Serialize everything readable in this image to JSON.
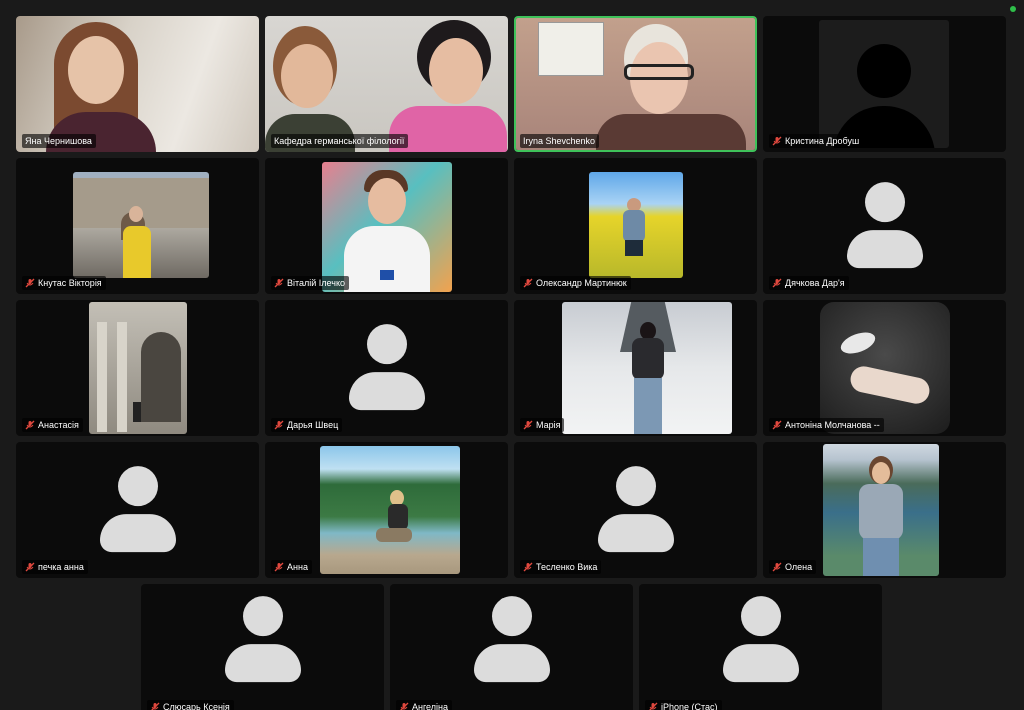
{
  "participants": [
    {
      "name": "Яна Чернишова",
      "muted": false,
      "type": "video"
    },
    {
      "name": "Кафедра германської філології",
      "muted": false,
      "type": "video"
    },
    {
      "name": "Iryna Shevchenko",
      "muted": false,
      "type": "video",
      "active": true
    },
    {
      "name": "Кристина Дробуш",
      "muted": true,
      "type": "silhouette"
    },
    {
      "name": "Кнутас Вікторія",
      "muted": true,
      "type": "photo"
    },
    {
      "name": "Віталій Ілечко",
      "muted": true,
      "type": "photo"
    },
    {
      "name": "Олександр Мартинюк",
      "muted": true,
      "type": "photo"
    },
    {
      "name": "Дячкова Дар'я",
      "muted": true,
      "type": "avatar"
    },
    {
      "name": "Анастасія",
      "muted": true,
      "type": "photo"
    },
    {
      "name": "Дарья Швец",
      "muted": true,
      "type": "avatar"
    },
    {
      "name": "Марія",
      "muted": true,
      "type": "photo"
    },
    {
      "name": "Антоніна Молчанова --",
      "muted": true,
      "type": "photo"
    },
    {
      "name": "печка анна",
      "muted": true,
      "type": "avatar"
    },
    {
      "name": "Анна",
      "muted": true,
      "type": "photo"
    },
    {
      "name": "Тесленко Вика",
      "muted": true,
      "type": "avatar"
    },
    {
      "name": "Олена",
      "muted": true,
      "type": "photo"
    },
    {
      "name": "Слюсарь Ксенія",
      "muted": true,
      "type": "avatar"
    },
    {
      "name": "Ангеліна",
      "muted": true,
      "type": "avatar"
    },
    {
      "name": "iPhone (Стас)",
      "muted": true,
      "type": "avatar"
    }
  ],
  "colors": {
    "active_speaker": "#3fc25a",
    "muted_mic": "#e0483e",
    "background": "#1a1a1a",
    "tile": "#0b0b0b"
  },
  "icons": {
    "muted": "mic-off-icon",
    "avatar": "person-avatar-icon"
  }
}
